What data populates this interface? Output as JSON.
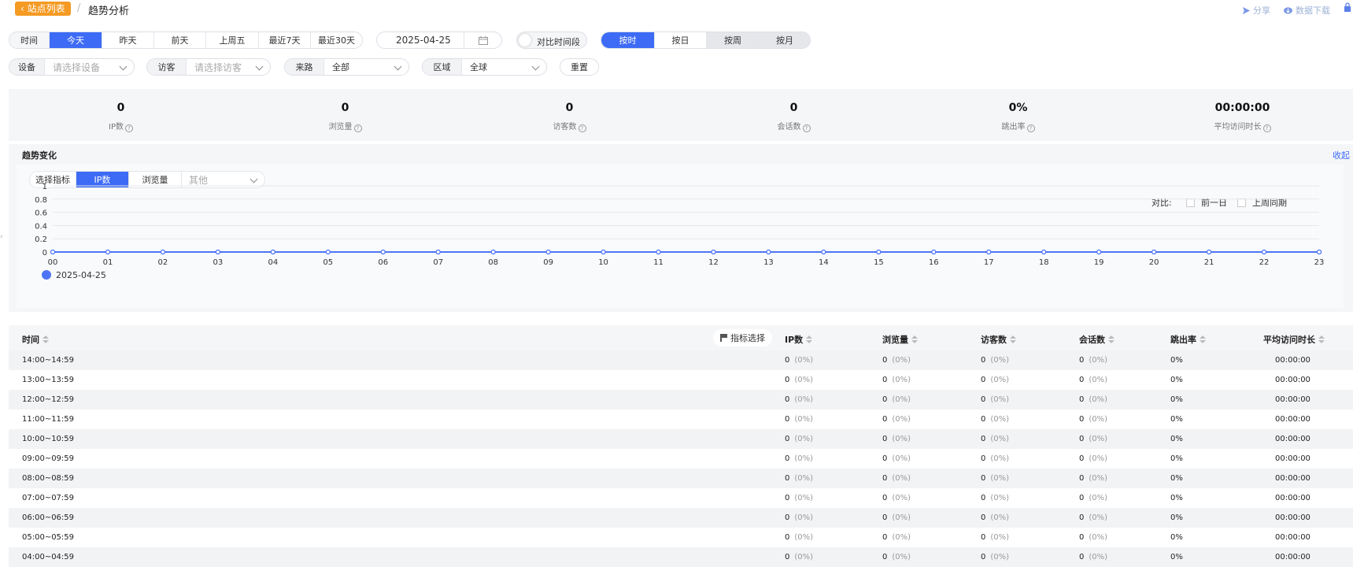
{
  "header": {
    "back_label": "站点列表",
    "separator": "/",
    "title": "趋势分析",
    "share_label": "分享",
    "download_label": "数据下载"
  },
  "time_range": {
    "label": "时间",
    "options": [
      "今天",
      "昨天",
      "前天",
      "上周五",
      "最近7天",
      "最近30天"
    ],
    "selected": "今天"
  },
  "date": {
    "value": "2025-04-25"
  },
  "compare_toggle": {
    "label": "对比时间段"
  },
  "granularity": {
    "options": [
      "按时",
      "按日",
      "按周",
      "按月"
    ],
    "selected": "按时"
  },
  "filters": {
    "device": {
      "label": "设备",
      "placeholder": "请选择设备"
    },
    "visitor": {
      "label": "访客",
      "placeholder": "请选择访客"
    },
    "source": {
      "label": "来路",
      "value": "全部"
    },
    "region": {
      "label": "区域",
      "value": "全球"
    },
    "reset_label": "重置"
  },
  "stats": [
    {
      "value": "0",
      "label": "IP数"
    },
    {
      "value": "0",
      "label": "浏览量"
    },
    {
      "value": "0",
      "label": "访客数"
    },
    {
      "value": "0",
      "label": "会话数"
    },
    {
      "value": "0%",
      "label": "跳出率"
    },
    {
      "value": "00:00:00",
      "label": "平均访问时长"
    }
  ],
  "trend": {
    "title": "趋势变化",
    "collapse_label": "收起",
    "metric_label": "选择指标",
    "metric_options": [
      "IP数",
      "浏览量"
    ],
    "metric_selected": "IP数",
    "metric_other_placeholder": "其他",
    "compare_label": "对比:",
    "compare_options": [
      "前一日",
      "上周同期"
    ]
  },
  "chart_data": {
    "type": "line",
    "x": [
      "00",
      "01",
      "02",
      "03",
      "04",
      "05",
      "06",
      "07",
      "08",
      "09",
      "10",
      "11",
      "12",
      "13",
      "14",
      "15",
      "16",
      "17",
      "18",
      "19",
      "20",
      "21",
      "22",
      "23"
    ],
    "yticks": [
      "0",
      "0.2",
      "0.4",
      "0.6",
      "0.8",
      "1"
    ],
    "ylim": [
      0,
      1
    ],
    "series": [
      {
        "name": "2025-04-25",
        "color": "#4e74f6",
        "values": [
          0,
          0,
          0,
          0,
          0,
          0,
          0,
          0,
          0,
          0,
          0,
          0,
          0,
          0,
          0,
          0,
          0,
          0,
          0,
          0,
          0,
          0,
          0,
          0
        ]
      }
    ],
    "grid": true,
    "legend": "bottom-left"
  },
  "table": {
    "pick_label": "指标选择",
    "headers": [
      "时间",
      "IP数",
      "浏览量",
      "访客数",
      "会话数",
      "跳出率",
      "平均访问时长"
    ],
    "rows": [
      {
        "time": "14:00~14:59",
        "ip": "0",
        "ip_pct": "(0%)",
        "pv": "0",
        "pv_pct": "(0%)",
        "uv": "0",
        "uv_pct": "(0%)",
        "sess": "0",
        "sess_pct": "(0%)",
        "bounce": "0%",
        "avg": "00:00:00"
      },
      {
        "time": "13:00~13:59",
        "ip": "0",
        "ip_pct": "(0%)",
        "pv": "0",
        "pv_pct": "(0%)",
        "uv": "0",
        "uv_pct": "(0%)",
        "sess": "0",
        "sess_pct": "(0%)",
        "bounce": "0%",
        "avg": "00:00:00"
      },
      {
        "time": "12:00~12:59",
        "ip": "0",
        "ip_pct": "(0%)",
        "pv": "0",
        "pv_pct": "(0%)",
        "uv": "0",
        "uv_pct": "(0%)",
        "sess": "0",
        "sess_pct": "(0%)",
        "bounce": "0%",
        "avg": "00:00:00"
      },
      {
        "time": "11:00~11:59",
        "ip": "0",
        "ip_pct": "(0%)",
        "pv": "0",
        "pv_pct": "(0%)",
        "uv": "0",
        "uv_pct": "(0%)",
        "sess": "0",
        "sess_pct": "(0%)",
        "bounce": "0%",
        "avg": "00:00:00"
      },
      {
        "time": "10:00~10:59",
        "ip": "0",
        "ip_pct": "(0%)",
        "pv": "0",
        "pv_pct": "(0%)",
        "uv": "0",
        "uv_pct": "(0%)",
        "sess": "0",
        "sess_pct": "(0%)",
        "bounce": "0%",
        "avg": "00:00:00"
      },
      {
        "time": "09:00~09:59",
        "ip": "0",
        "ip_pct": "(0%)",
        "pv": "0",
        "pv_pct": "(0%)",
        "uv": "0",
        "uv_pct": "(0%)",
        "sess": "0",
        "sess_pct": "(0%)",
        "bounce": "0%",
        "avg": "00:00:00"
      },
      {
        "time": "08:00~08:59",
        "ip": "0",
        "ip_pct": "(0%)",
        "pv": "0",
        "pv_pct": "(0%)",
        "uv": "0",
        "uv_pct": "(0%)",
        "sess": "0",
        "sess_pct": "(0%)",
        "bounce": "0%",
        "avg": "00:00:00"
      },
      {
        "time": "07:00~07:59",
        "ip": "0",
        "ip_pct": "(0%)",
        "pv": "0",
        "pv_pct": "(0%)",
        "uv": "0",
        "uv_pct": "(0%)",
        "sess": "0",
        "sess_pct": "(0%)",
        "bounce": "0%",
        "avg": "00:00:00"
      },
      {
        "time": "06:00~06:59",
        "ip": "0",
        "ip_pct": "(0%)",
        "pv": "0",
        "pv_pct": "(0%)",
        "uv": "0",
        "uv_pct": "(0%)",
        "sess": "0",
        "sess_pct": "(0%)",
        "bounce": "0%",
        "avg": "00:00:00"
      },
      {
        "time": "05:00~05:59",
        "ip": "0",
        "ip_pct": "(0%)",
        "pv": "0",
        "pv_pct": "(0%)",
        "uv": "0",
        "uv_pct": "(0%)",
        "sess": "0",
        "sess_pct": "(0%)",
        "bounce": "0%",
        "avg": "00:00:00"
      },
      {
        "time": "04:00~04:59",
        "ip": "0",
        "ip_pct": "(0%)",
        "pv": "0",
        "pv_pct": "(0%)",
        "uv": "0",
        "uv_pct": "(0%)",
        "sess": "0",
        "sess_pct": "(0%)",
        "bounce": "0%",
        "avg": "00:00:00"
      }
    ]
  }
}
